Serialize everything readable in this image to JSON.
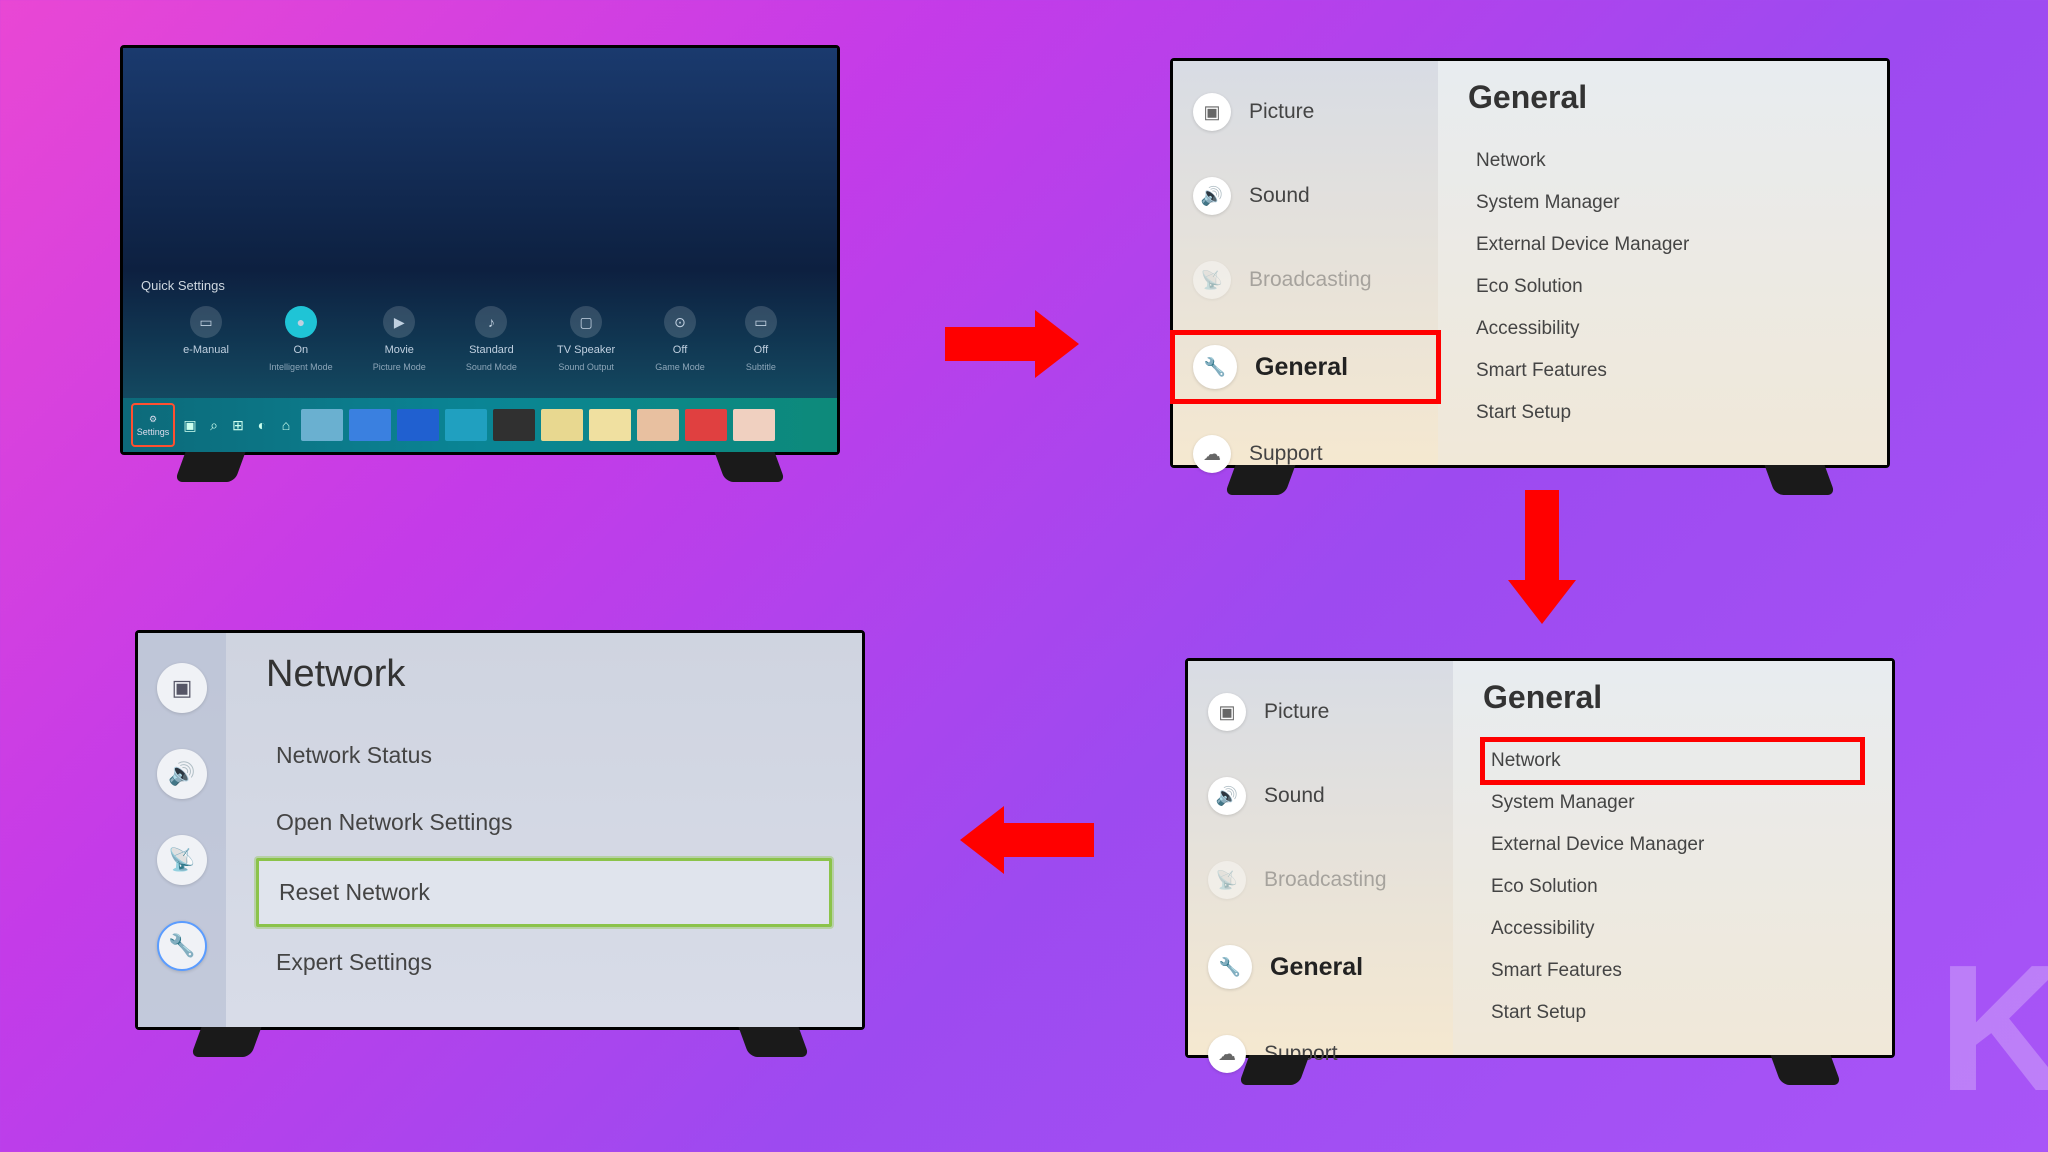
{
  "tv1": {
    "quick_settings_label": "Quick Settings",
    "items": [
      {
        "title": "e-Manual",
        "sub": ""
      },
      {
        "title": "On",
        "sub": "Intelligent Mode"
      },
      {
        "title": "Movie",
        "sub": "Picture Mode"
      },
      {
        "title": "Standard",
        "sub": "Sound Mode"
      },
      {
        "title": "TV Speaker",
        "sub": "Sound Output"
      },
      {
        "title": "Off",
        "sub": "Game Mode"
      },
      {
        "title": "Off",
        "sub": "Subtitle"
      }
    ],
    "settings_label": "Settings"
  },
  "tv2": {
    "left_items": [
      {
        "label": "Picture",
        "icon": "picture"
      },
      {
        "label": "Sound",
        "icon": "sound"
      },
      {
        "label": "Broadcasting",
        "icon": "broadcast",
        "disabled": true
      },
      {
        "label": "General",
        "icon": "wrench",
        "selected": true
      },
      {
        "label": "Support",
        "icon": "cloud"
      }
    ],
    "right_title": "General",
    "right_items": [
      "Network",
      "System Manager",
      "External Device Manager",
      "Eco Solution",
      "Accessibility",
      "Smart Features",
      "Start Setup"
    ]
  },
  "tv3": {
    "left_items": [
      {
        "label": "Picture",
        "icon": "picture"
      },
      {
        "label": "Sound",
        "icon": "sound"
      },
      {
        "label": "Broadcasting",
        "icon": "broadcast",
        "disabled": true
      },
      {
        "label": "General",
        "icon": "wrench",
        "selected": true
      },
      {
        "label": "Support",
        "icon": "cloud"
      }
    ],
    "right_title": "General",
    "right_items": [
      "Network",
      "System Manager",
      "External Device Manager",
      "Eco Solution",
      "Accessibility",
      "Smart Features",
      "Start Setup"
    ]
  },
  "tv4": {
    "title": "Network",
    "items": [
      "Network Status",
      "Open Network Settings",
      "Reset Network",
      "Expert Settings"
    ],
    "highlighted_index": 2
  }
}
